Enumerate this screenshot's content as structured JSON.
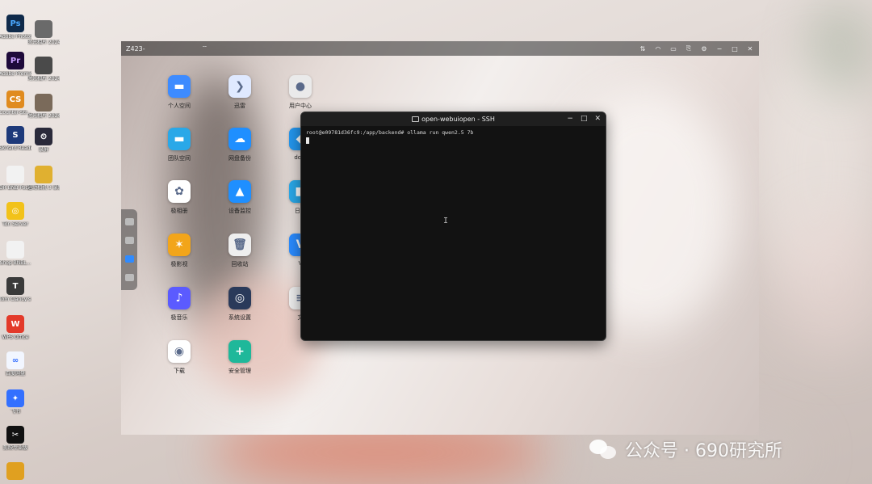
{
  "desktop": {
    "icons": [
      {
        "label": "Adobe Photosh...",
        "glyph": "Ps",
        "color": "#0f2a4a",
        "fg": "#4aa8ff"
      },
      {
        "label": "时光相片 2024-10...",
        "glyph": "",
        "color": "#6a6a6a",
        "fg": "#fff"
      },
      {
        "label": "Adobe Premie...",
        "glyph": "Pr",
        "color": "#1e0a3a",
        "fg": "#c9a0ff"
      },
      {
        "label": "时光相片 2024-10...",
        "glyph": "",
        "color": "#4a4a4a",
        "fg": "#fff"
      },
      {
        "label": "Counter-Str...",
        "glyph": "CS",
        "color": "#e08b1f",
        "fg": "#fff"
      },
      {
        "label": "时光相片 2024-10...",
        "glyph": "",
        "color": "#7a6a5a",
        "fg": "#fff"
      },
      {
        "label": "SkiYard Reader",
        "glyph": "S",
        "color": "#1e3a7a",
        "fg": "#fff"
      },
      {
        "label": "录屏",
        "glyph": "⏲",
        "color": "#2a2a3a",
        "fg": "#fff"
      },
      {
        "label": "DR BNB Pocket 3...",
        "glyph": "",
        "color": "#f2f2f2",
        "fg": "#555"
      },
      {
        "label": "运动相机 3 录制...",
        "glyph": "",
        "color": "#e0b030",
        "fg": "#fff"
      },
      {
        "label": "Ton Server",
        "glyph": "◎",
        "color": "#f2c21a",
        "fg": "#fff"
      },
      {
        "label": "Shop BNBL...",
        "glyph": "",
        "color": "#f2f2f2",
        "fg": "#555"
      },
      {
        "label": "Tom Clancy's Di...",
        "glyph": "T",
        "color": "#3a3a3a",
        "fg": "#fff"
      },
      {
        "label": "WPS Office",
        "glyph": "W",
        "color": "#e33a2a",
        "fg": "#fff"
      },
      {
        "label": "百度网盘",
        "glyph": "∞",
        "color": "#f2f6ff",
        "fg": "#2f6bff"
      },
      {
        "label": "飞书",
        "glyph": "✦",
        "color": "#3370ff",
        "fg": "#fff"
      },
      {
        "label": "剪映专业版",
        "glyph": "✂",
        "color": "#111",
        "fg": "#fff"
      },
      {
        "label": "",
        "glyph": "",
        "color": "#e0a020",
        "fg": "#fff"
      }
    ]
  },
  "nas": {
    "title": "Z423-",
    "apps": [
      {
        "label": "个人空间",
        "glyph": "▬",
        "color": "#3d8bff"
      },
      {
        "label": "迅雷",
        "glyph": "❯",
        "color": "#dfe9ff"
      },
      {
        "label": "用户中心",
        "glyph": "●",
        "color": "#eaeaea"
      },
      {
        "label": "团队空间",
        "glyph": "▬",
        "color": "#29a8e8"
      },
      {
        "label": "网盘备份",
        "glyph": "☁",
        "color": "#1f8fff"
      },
      {
        "label": "do...",
        "glyph": "◆",
        "color": "#2496ed"
      },
      {
        "label": "极相册",
        "glyph": "✿",
        "color": "#ffffff"
      },
      {
        "label": "设备监控",
        "glyph": "▲",
        "color": "#1f8fff"
      },
      {
        "label": "日程",
        "glyph": "■",
        "color": "#29a8e8"
      },
      {
        "label": "极影视",
        "glyph": "✶",
        "color": "#f2a51a"
      },
      {
        "label": "回收站",
        "glyph": "🗑",
        "color": "#eeeeee"
      },
      {
        "label": "V",
        "glyph": "V",
        "color": "#2a8bff"
      },
      {
        "label": "极音乐",
        "glyph": "♪",
        "color": "#5b5bff"
      },
      {
        "label": "系统设置",
        "glyph": "◎",
        "color": "#2a3a5a"
      },
      {
        "label": "文",
        "glyph": "≡",
        "color": "#eeeeee"
      },
      {
        "label": "下载",
        "glyph": "◉",
        "color": "#ffffff"
      },
      {
        "label": "安全管理",
        "glyph": "+",
        "color": "#1fb89a"
      }
    ]
  },
  "ssh": {
    "title": "open-webuiopen - SSH",
    "command_line": "root@e09781d36fc9:/app/backend# ollama run qwen2.5 7b"
  },
  "watermark": {
    "text": "公众号 · 690研究所"
  }
}
